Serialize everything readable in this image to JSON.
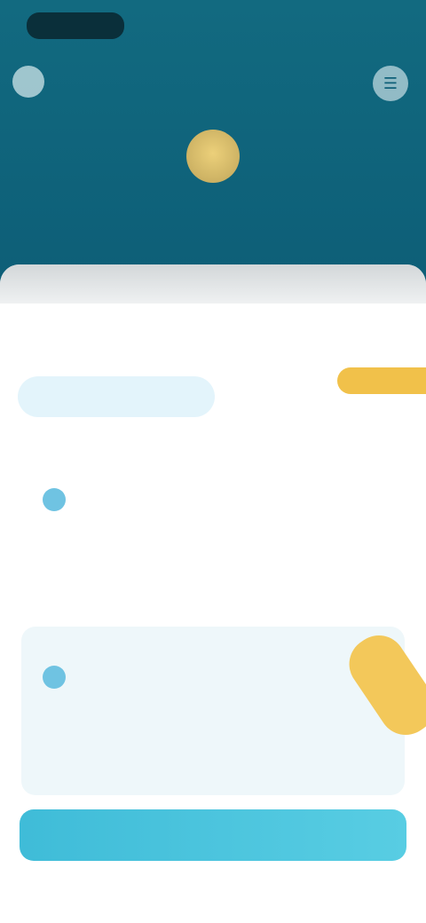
{
  "status_bar": {
    "time": "",
    "icons": ""
  },
  "topbar": {
    "brand_name": "",
    "menu_icon": "menu-icon"
  },
  "profile": {
    "name": "",
    "subtitle": ""
  },
  "promo": {
    "label": ""
  },
  "tabs": [
    {
      "label": ""
    },
    {
      "label": ""
    }
  ],
  "cards": [
    {
      "label": "",
      "amount": "",
      "note": ""
    },
    {
      "label": "",
      "amount": "",
      "note": ""
    }
  ],
  "ribbon": {
    "label": ""
  },
  "cta": {
    "label": ""
  },
  "colors": {
    "header": "#0d5e77",
    "accent": "#3fbcd8",
    "highlight": "#f1c14a",
    "avatar": "#d9bd63"
  }
}
